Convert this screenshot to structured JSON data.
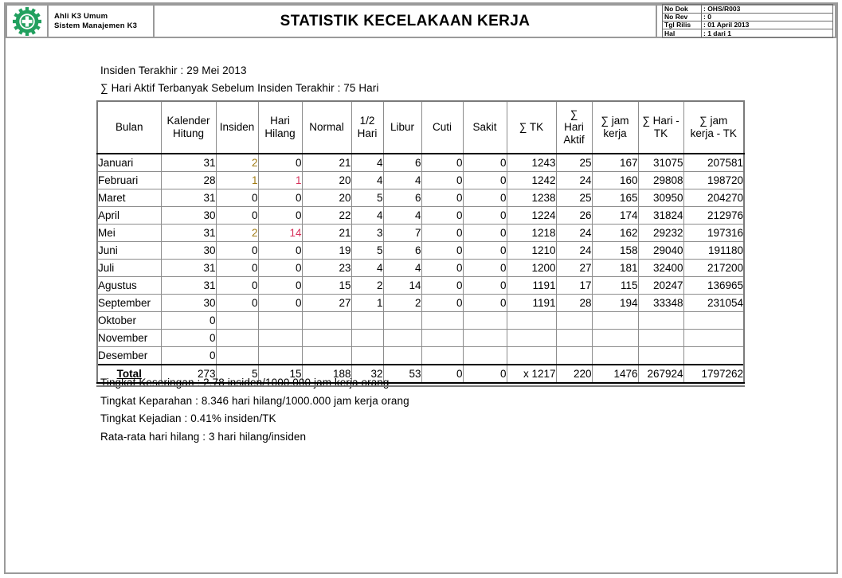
{
  "header": {
    "logo_icon": "gear-cross-icon",
    "org_line_1": "Ahli K3 Umum",
    "org_line_2": "Sistem Manajemen K3",
    "title": "STATISTIK KECELAKAAN KERJA",
    "meta": [
      {
        "key": "No Dok",
        "value": ": OHS/R003"
      },
      {
        "key": "No Rev",
        "value": ": 0"
      },
      {
        "key": "Tgl Rilis",
        "value": ": 01 April 2013"
      },
      {
        "key": "Hal",
        "value": ": 1 dari 1"
      }
    ]
  },
  "info": {
    "line_1": "Insiden Terakhir : 29 Mei 2013",
    "line_2": "∑ Hari Aktif Terbanyak Sebelum Insiden Terakhir : 75 Hari"
  },
  "table": {
    "columns": [
      {
        "label": "Bulan"
      },
      {
        "label": "Kalender\nHitung"
      },
      {
        "label": "Insiden"
      },
      {
        "label": "Hari\nHilang"
      },
      {
        "label": "Normal"
      },
      {
        "label": "1/2\nHari"
      },
      {
        "label": "Libur"
      },
      {
        "label": "Cuti"
      },
      {
        "label": "∑ TK"
      },
      {
        "label": "∑\nHari\nAktif"
      },
      {
        "label": "∑ jam\nkerja"
      },
      {
        "label": "∑ Hari -\nTK"
      },
      {
        "label": "∑ jam\nkerja - TK"
      }
    ],
    "column_labels": {
      "bulan": "Bulan",
      "kalender_hitung_1": "Kalender",
      "kalender_hitung_2": "Hitung",
      "insiden": "Insiden",
      "hari_hilang_1": "Hari",
      "hari_hilang_2": "Hilang",
      "normal": "Normal",
      "setengah_hari_1": "1/2",
      "setengah_hari_2": "Hari",
      "libur": "Libur",
      "cuti": "Cuti",
      "sakit": "Sakit",
      "sum_tk": "∑ TK",
      "sum_hari_aktif_1": "∑",
      "sum_hari_aktif_2": "Hari",
      "sum_hari_aktif_3": "Aktif",
      "sum_jam_kerja_1": "∑ jam",
      "sum_jam_kerja_2": "kerja",
      "sum_hari_tk_1": "∑ Hari -",
      "sum_hari_tk_2": "TK",
      "sum_jam_kerja_tk_1": "∑ jam",
      "sum_jam_kerja_tk_2": "kerja - TK"
    },
    "rows": [
      {
        "bulan": "Januari",
        "kalender": "31",
        "insiden": "2",
        "hari_hilang": "0",
        "normal": "21",
        "setengah": "4",
        "libur": "6",
        "cuti": "0",
        "sakit": "0",
        "sum_tk": "1243",
        "hari_aktif": "25",
        "jam_kerja": "167",
        "hari_tk": "31075",
        "jam_kerja_tk": "207581",
        "insiden_hl": "yellow",
        "hilang_hl": "none"
      },
      {
        "bulan": "Februari",
        "kalender": "28",
        "insiden": "1",
        "hari_hilang": "1",
        "normal": "20",
        "setengah": "4",
        "libur": "4",
        "cuti": "0",
        "sakit": "0",
        "sum_tk": "1242",
        "hari_aktif": "24",
        "jam_kerja": "160",
        "hari_tk": "29808",
        "jam_kerja_tk": "198720",
        "insiden_hl": "yellow",
        "hilang_hl": "pink"
      },
      {
        "bulan": "Maret",
        "kalender": "31",
        "insiden": "0",
        "hari_hilang": "0",
        "normal": "20",
        "setengah": "5",
        "libur": "6",
        "cuti": "0",
        "sakit": "0",
        "sum_tk": "1238",
        "hari_aktif": "25",
        "jam_kerja": "165",
        "hari_tk": "30950",
        "jam_kerja_tk": "204270",
        "insiden_hl": "none",
        "hilang_hl": "none"
      },
      {
        "bulan": "April",
        "kalender": "30",
        "insiden": "0",
        "hari_hilang": "0",
        "normal": "22",
        "setengah": "4",
        "libur": "4",
        "cuti": "0",
        "sakit": "0",
        "sum_tk": "1224",
        "hari_aktif": "26",
        "jam_kerja": "174",
        "hari_tk": "31824",
        "jam_kerja_tk": "212976",
        "insiden_hl": "none",
        "hilang_hl": "none"
      },
      {
        "bulan": "Mei",
        "kalender": "31",
        "insiden": "2",
        "hari_hilang": "14",
        "normal": "21",
        "setengah": "3",
        "libur": "7",
        "cuti": "0",
        "sakit": "0",
        "sum_tk": "1218",
        "hari_aktif": "24",
        "jam_kerja": "162",
        "hari_tk": "29232",
        "jam_kerja_tk": "197316",
        "insiden_hl": "yellow",
        "hilang_hl": "pink"
      },
      {
        "bulan": "Juni",
        "kalender": "30",
        "insiden": "0",
        "hari_hilang": "0",
        "normal": "19",
        "setengah": "5",
        "libur": "6",
        "cuti": "0",
        "sakit": "0",
        "sum_tk": "1210",
        "hari_aktif": "24",
        "jam_kerja": "158",
        "hari_tk": "29040",
        "jam_kerja_tk": "191180",
        "insiden_hl": "none",
        "hilang_hl": "none"
      },
      {
        "bulan": "Juli",
        "kalender": "31",
        "insiden": "0",
        "hari_hilang": "0",
        "normal": "23",
        "setengah": "4",
        "libur": "4",
        "cuti": "0",
        "sakit": "0",
        "sum_tk": "1200",
        "hari_aktif": "27",
        "jam_kerja": "181",
        "hari_tk": "32400",
        "jam_kerja_tk": "217200",
        "insiden_hl": "none",
        "hilang_hl": "none"
      },
      {
        "bulan": "Agustus",
        "kalender": "31",
        "insiden": "0",
        "hari_hilang": "0",
        "normal": "15",
        "setengah": "2",
        "libur": "14",
        "cuti": "0",
        "sakit": "0",
        "sum_tk": "1191",
        "hari_aktif": "17",
        "jam_kerja": "115",
        "hari_tk": "20247",
        "jam_kerja_tk": "136965",
        "insiden_hl": "none",
        "hilang_hl": "none"
      },
      {
        "bulan": "September",
        "kalender": "30",
        "insiden": "0",
        "hari_hilang": "0",
        "normal": "27",
        "setengah": "1",
        "libur": "2",
        "cuti": "0",
        "sakit": "0",
        "sum_tk": "1191",
        "hari_aktif": "28",
        "jam_kerja": "194",
        "hari_tk": "33348",
        "jam_kerja_tk": "231054",
        "insiden_hl": "none",
        "hilang_hl": "none"
      },
      {
        "bulan": "Oktober",
        "kalender": "0",
        "insiden": "",
        "hari_hilang": "",
        "normal": "",
        "setengah": "",
        "libur": "",
        "cuti": "",
        "sakit": "",
        "sum_tk": "",
        "hari_aktif": "",
        "jam_kerja": "",
        "hari_tk": "",
        "jam_kerja_tk": "",
        "insiden_hl": "none",
        "hilang_hl": "none"
      },
      {
        "bulan": "November",
        "kalender": "0",
        "insiden": "",
        "hari_hilang": "",
        "normal": "",
        "setengah": "",
        "libur": "",
        "cuti": "",
        "sakit": "",
        "sum_tk": "",
        "hari_aktif": "",
        "jam_kerja": "",
        "hari_tk": "",
        "jam_kerja_tk": "",
        "insiden_hl": "none",
        "hilang_hl": "none"
      },
      {
        "bulan": "Desember",
        "kalender": "0",
        "insiden": "",
        "hari_hilang": "",
        "normal": "",
        "setengah": "",
        "libur": "",
        "cuti": "",
        "sakit": "",
        "sum_tk": "",
        "hari_aktif": "",
        "jam_kerja": "",
        "hari_tk": "",
        "jam_kerja_tk": "",
        "insiden_hl": "none",
        "hilang_hl": "none"
      }
    ],
    "total": {
      "bulan": "Total",
      "kalender": "273",
      "insiden": "5",
      "hari_hilang": "15",
      "normal": "188",
      "setengah": "32",
      "libur": "53",
      "cuti": "0",
      "sakit": "0",
      "sum_tk": "x 1217",
      "hari_aktif": "220",
      "jam_kerja": "1476",
      "hari_tk": "267924",
      "jam_kerja_tk": "1797262"
    }
  },
  "notes": {
    "line_1": "Tingkat Keseringan : 2.78 insiden/1000.000 jam kerja orang",
    "line_2": "Tingkat Keparahan : 8.346 hari hilang/1000.000 jam kerja orang",
    "line_3": "Tingkat Kejadian : 0.41% insiden/TK",
    "line_4": "Rata-rata hari hilang : 3 hari hilang/insiden"
  },
  "colors": {
    "logo_green": "#22a05f",
    "highlight_yellow_bg": "#fbe49c",
    "highlight_yellow_text": "#a07a12",
    "highlight_pink_bg": "#fbccd4",
    "highlight_pink_text": "#d6315a",
    "frame_gray": "#9a9a9a"
  }
}
